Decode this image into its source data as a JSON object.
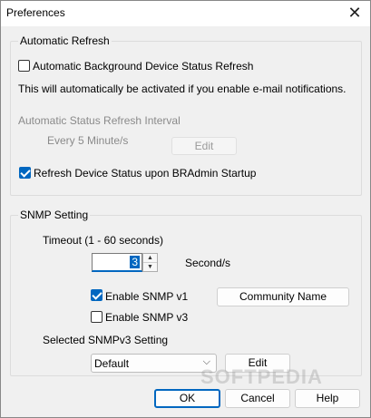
{
  "window": {
    "title": "Preferences",
    "close_glyph": "✕"
  },
  "auto_refresh": {
    "group_title": "Automatic Refresh",
    "background_refresh_label": "Automatic Background Device Status Refresh",
    "background_refresh_checked": false,
    "info_text": "This will automatically be activated if you enable e-mail notifications.",
    "interval_label": "Automatic Status Refresh Interval",
    "interval_value": "Every 5 Minute/s",
    "edit_label": "Edit",
    "startup_refresh_label": "Refresh Device Status upon BRAdmin Startup",
    "startup_refresh_checked": true
  },
  "snmp": {
    "group_title": "SNMP Setting",
    "timeout_label": "Timeout (1 - 60 seconds)",
    "timeout_value": "3",
    "timeout_unit": "Second/s",
    "enable_v1_label": "Enable SNMP v1",
    "enable_v1_checked": true,
    "community_button": "Community Name",
    "enable_v3_label": "Enable SNMP v3",
    "enable_v3_checked": false,
    "v3_setting_label": "Selected SNMPv3 Setting",
    "v3_selected": "Default",
    "v3_edit_label": "Edit"
  },
  "footer": {
    "ok_label": "OK",
    "cancel_label": "Cancel",
    "help_label": "Help"
  },
  "watermark_text": "SOFTPEDIA"
}
